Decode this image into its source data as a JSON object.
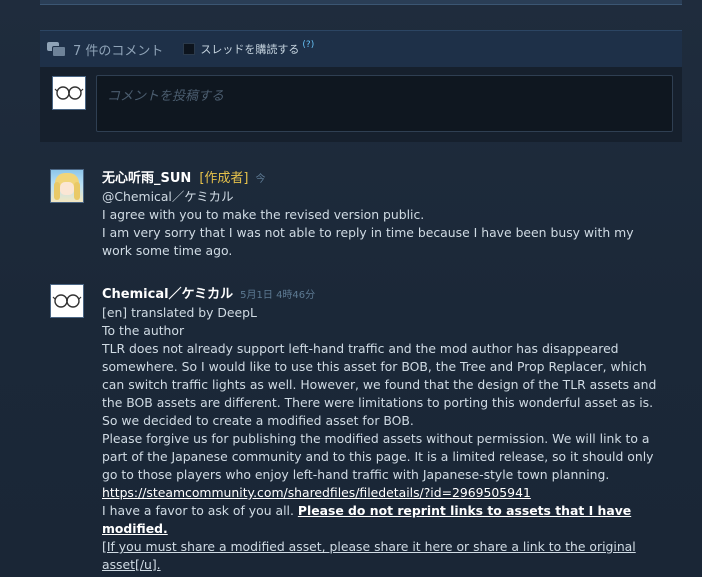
{
  "comments_header": {
    "count_label": "7 件のコメント",
    "subscribe_label": "スレッドを購読する",
    "help_mark": "(?)"
  },
  "compose": {
    "placeholder": "コメントを投稿する"
  },
  "comments": [
    {
      "author": "无心听雨_SUN",
      "badge": "[作成者]",
      "time": "今",
      "lines": [
        "@Chemical／ケミカル",
        "I agree with you to make the revised version public.",
        "I am very sorry that I was not able to reply in time because I have been busy with my work some time ago."
      ]
    },
    {
      "author": "Chemical／ケミカル",
      "time": "5月1日 4時46分",
      "lines": [
        "[en] translated by DeepL",
        "To the author",
        "TLR does not already support left-hand traffic and the mod author has disappeared somewhere. So I would like to use this asset for BOB, the Tree and Prop Replacer, which can switch traffic lights as well. However, we found that the design of the TLR assets and the BOB assets are different. There were limitations to porting this wonderful asset as is.",
        "So we decided to create a modified asset for BOB.",
        "Please forgive us for publishing the modified assets without permission. We will link to a part of the Japanese community and to this page. It is a limited release, so it should only go to those players who enjoy left-hand traffic with Japanese-style town planning."
      ],
      "link": "https://steamcommunity.com/sharedfiles/filedetails/?id=2969505941",
      "favor_text": "I have a favor to ask of you all.",
      "favor_bold": "Please do not reprint links to assets that I have modified.",
      "favor_tail": "[If you must share a modified asset, please share it here or share a link to the original asset[/u]."
    }
  ]
}
